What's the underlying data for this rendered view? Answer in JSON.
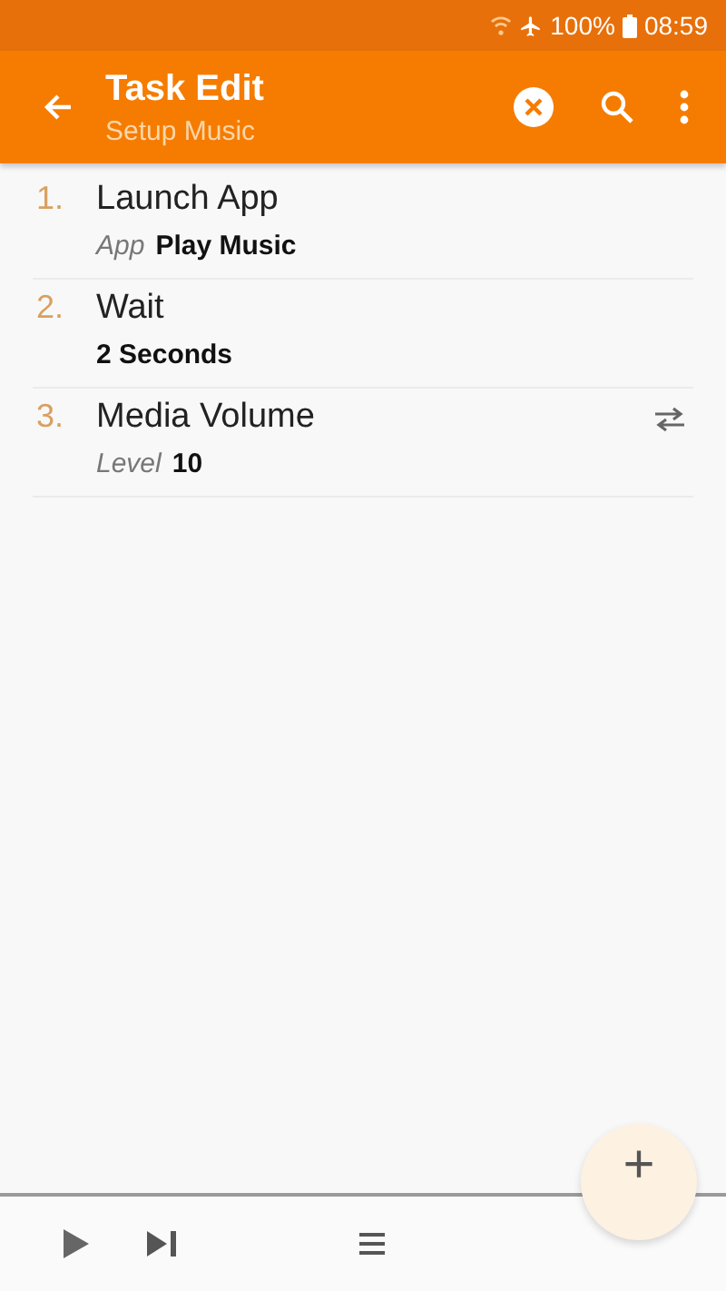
{
  "status_bar": {
    "battery": "100%",
    "time": "08:59"
  },
  "toolbar": {
    "title": "Task Edit",
    "subtitle": "Setup Music"
  },
  "actions": [
    {
      "number": "1.",
      "title": "Launch App",
      "param_label": "App",
      "param_value": "Play Music",
      "swap": false
    },
    {
      "number": "2.",
      "title": "Wait",
      "param_value": "2 Seconds",
      "swap": false
    },
    {
      "number": "3.",
      "title": "Media Volume",
      "param_label": "Level",
      "param_value": "10",
      "swap": true
    }
  ],
  "fab": {
    "label": "+"
  }
}
